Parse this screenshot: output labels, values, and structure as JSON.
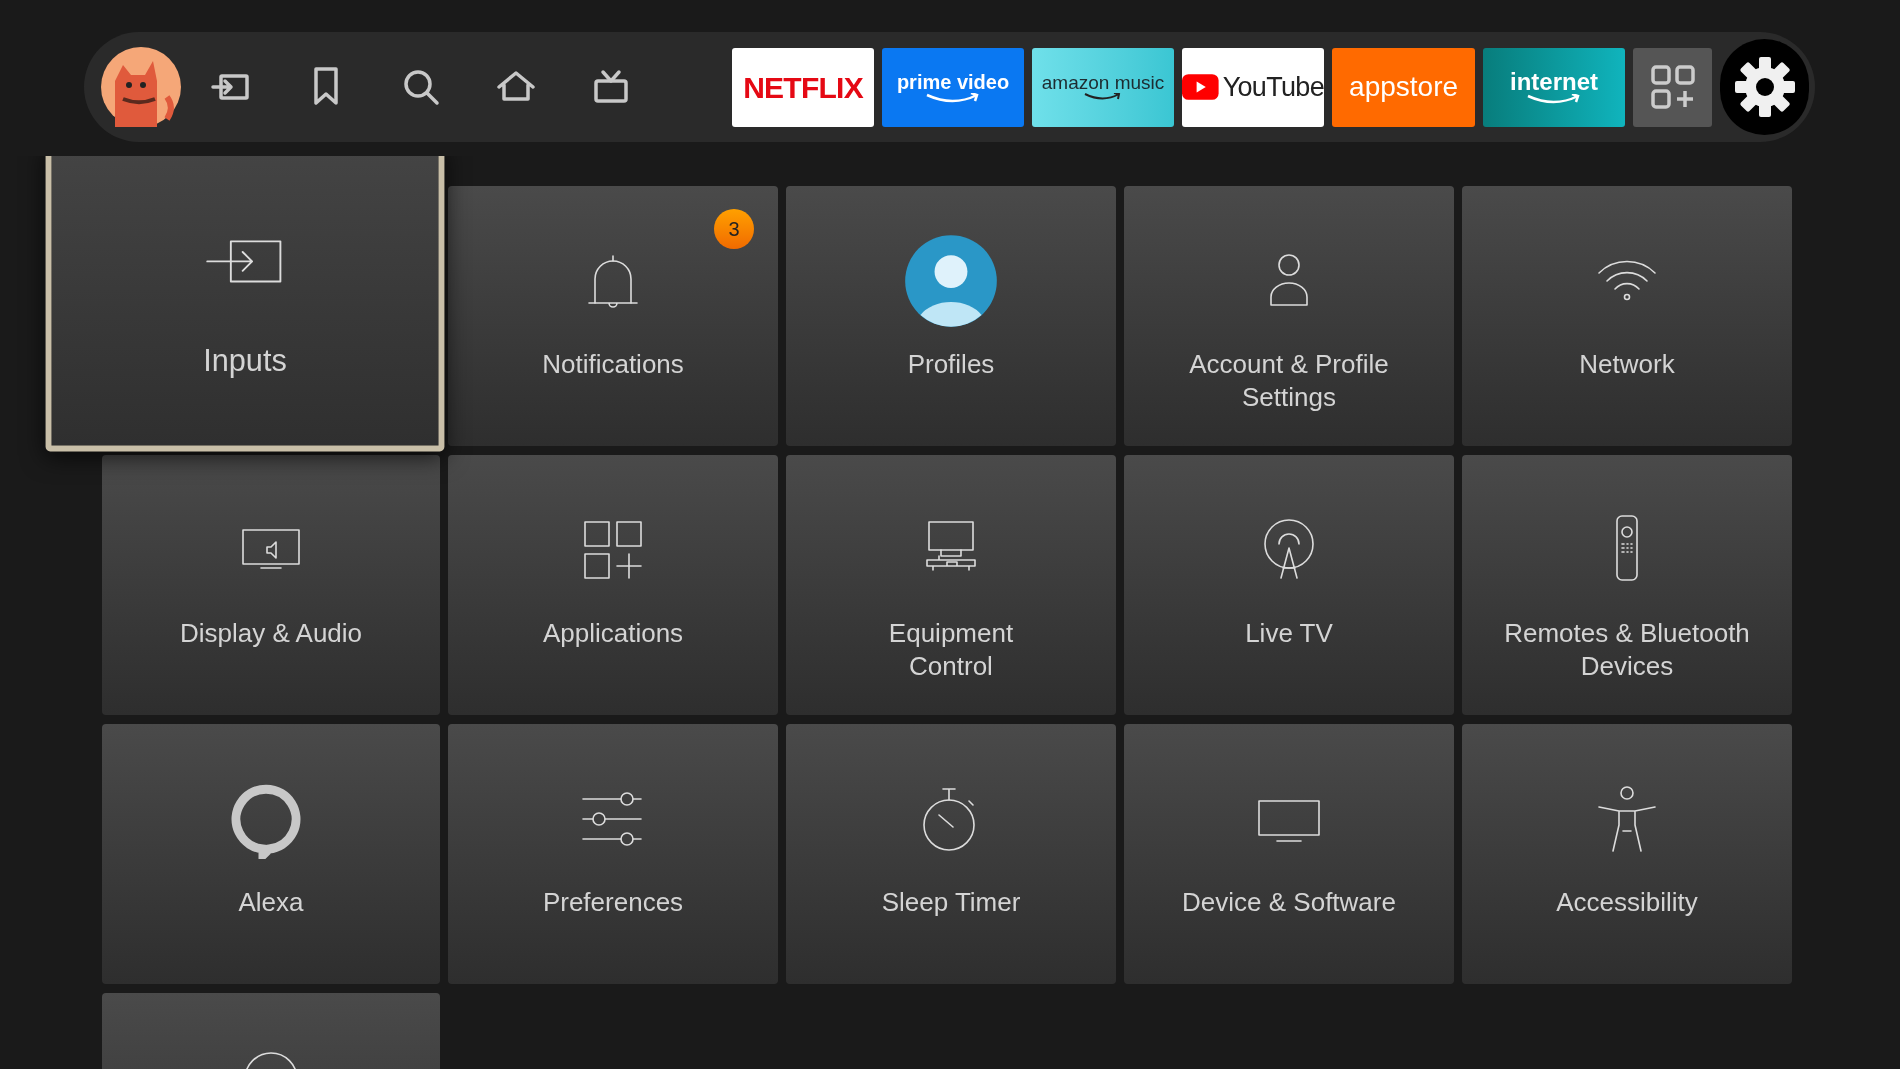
{
  "top_bar": {
    "nav": [
      {
        "kind": "inputs"
      },
      {
        "kind": "bookmark"
      },
      {
        "kind": "search"
      },
      {
        "kind": "home"
      },
      {
        "kind": "live"
      }
    ],
    "apps": [
      {
        "kind": "netflix",
        "label": "NETFLIX"
      },
      {
        "kind": "prime",
        "label": "prime video"
      },
      {
        "kind": "music",
        "label": "amazon music"
      },
      {
        "kind": "youtube",
        "label": "YouTube"
      },
      {
        "kind": "appstore",
        "label": "appstore"
      },
      {
        "kind": "internet",
        "label": "internet"
      },
      {
        "kind": "apps_grid"
      }
    ],
    "settings": {
      "selected": true
    }
  },
  "tiles": [
    {
      "kind": "inputs",
      "label": "Inputs",
      "selected": true
    },
    {
      "kind": "notifications",
      "label": "Notifications",
      "selected": false,
      "badge": "3"
    },
    {
      "kind": "profiles",
      "label": "Profiles",
      "selected": false
    },
    {
      "kind": "account",
      "label": "Account & Profile Settings",
      "selected": false
    },
    {
      "kind": "network",
      "label": "Network",
      "selected": false
    },
    {
      "kind": "display",
      "label": "Display & Audio",
      "selected": false
    },
    {
      "kind": "applications",
      "label": "Applications",
      "selected": false
    },
    {
      "kind": "equipment",
      "label": "Equipment\nControl",
      "selected": false
    },
    {
      "kind": "livetv",
      "label": "Live TV",
      "selected": false
    },
    {
      "kind": "remotes",
      "label": "Remotes & Bluetooth Devices",
      "selected": false
    },
    {
      "kind": "alexa",
      "label": "Alexa",
      "selected": false
    },
    {
      "kind": "preferences",
      "label": "Preferences",
      "selected": false
    },
    {
      "kind": "sleep",
      "label": "Sleep Timer",
      "selected": false
    },
    {
      "kind": "device",
      "label": "Device & Software",
      "selected": false
    },
    {
      "kind": "accessibility",
      "label": "Accessibility",
      "selected": false
    },
    {
      "kind": "partial",
      "selected": false
    }
  ]
}
